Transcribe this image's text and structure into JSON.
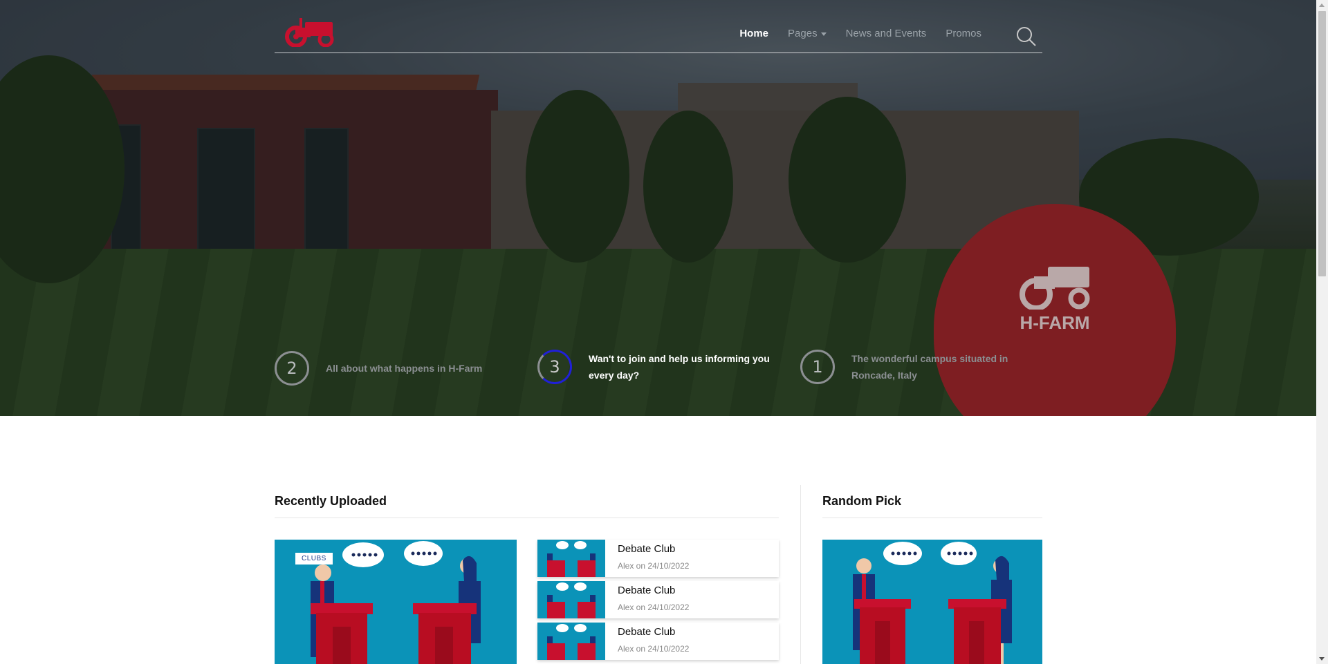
{
  "nav": {
    "logo_name": "tractor-logo",
    "items": [
      {
        "label": "Home",
        "active": true
      },
      {
        "label": "Pages",
        "dropdown": true
      },
      {
        "label": "News and Events"
      },
      {
        "label": "Promos"
      }
    ],
    "search_icon": "search-icon"
  },
  "hero": {
    "balloon_text": "H-FARM",
    "slides": [
      {
        "number": "2",
        "text": "All about what happens in H-Farm",
        "active": false
      },
      {
        "number": "3",
        "text": "Wan't to join and help us informing you every day?",
        "active": true
      },
      {
        "number": "1",
        "text": "The wonderful campus situated in Roncade, Italy",
        "active": false
      }
    ]
  },
  "recent": {
    "title": "Recently Uploaded",
    "feature_tag": "CLUBS",
    "items": [
      {
        "title": "Debate Club",
        "meta": "Alex on 24/10/2022"
      },
      {
        "title": "Debate Club",
        "meta": "Alex on 24/10/2022"
      },
      {
        "title": "Debate Club",
        "meta": "Alex on 24/10/2022"
      }
    ]
  },
  "random": {
    "title": "Random Pick"
  },
  "colors": {
    "brand_red": "#c8102e",
    "active_ring": "#2020d8",
    "illustration_bg": "#0b93b8"
  }
}
